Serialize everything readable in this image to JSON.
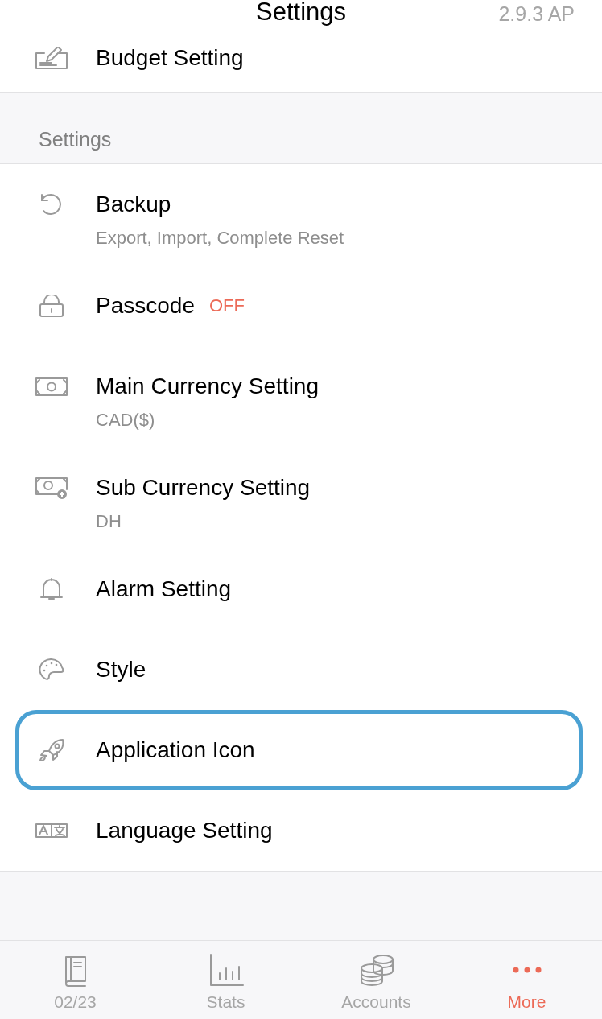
{
  "header": {
    "title": "Settings",
    "version": "2.9.3 AP"
  },
  "top_items": [
    {
      "kind": "budget",
      "title": "Budget Setting",
      "highlighted": false
    }
  ],
  "section": {
    "title": "Settings",
    "items": [
      {
        "kind": "backup",
        "title": "Backup",
        "subtitle": "Export, Import, Complete Reset",
        "highlighted": false
      },
      {
        "kind": "lock",
        "title": "Passcode",
        "badge": "OFF",
        "highlighted": false
      },
      {
        "kind": "money",
        "title": "Main Currency Setting",
        "subtitle": "CAD($)",
        "highlighted": false
      },
      {
        "kind": "money-plus",
        "title": "Sub Currency Setting",
        "subtitle": "DH",
        "highlighted": false
      },
      {
        "kind": "bell",
        "title": "Alarm Setting",
        "highlighted": false
      },
      {
        "kind": "palette",
        "title": "Style",
        "highlighted": false
      },
      {
        "kind": "rocket",
        "title": "Application Icon",
        "highlighted": true
      },
      {
        "kind": "language",
        "title": "Language Setting",
        "highlighted": false
      }
    ]
  },
  "tab_bar": [
    {
      "kind": "book",
      "label": "02/23",
      "selected": false
    },
    {
      "kind": "chart",
      "label": "Stats",
      "selected": false
    },
    {
      "kind": "coins",
      "label": "Accounts",
      "selected": false
    },
    {
      "kind": "dots",
      "label": "More",
      "selected": true
    }
  ]
}
